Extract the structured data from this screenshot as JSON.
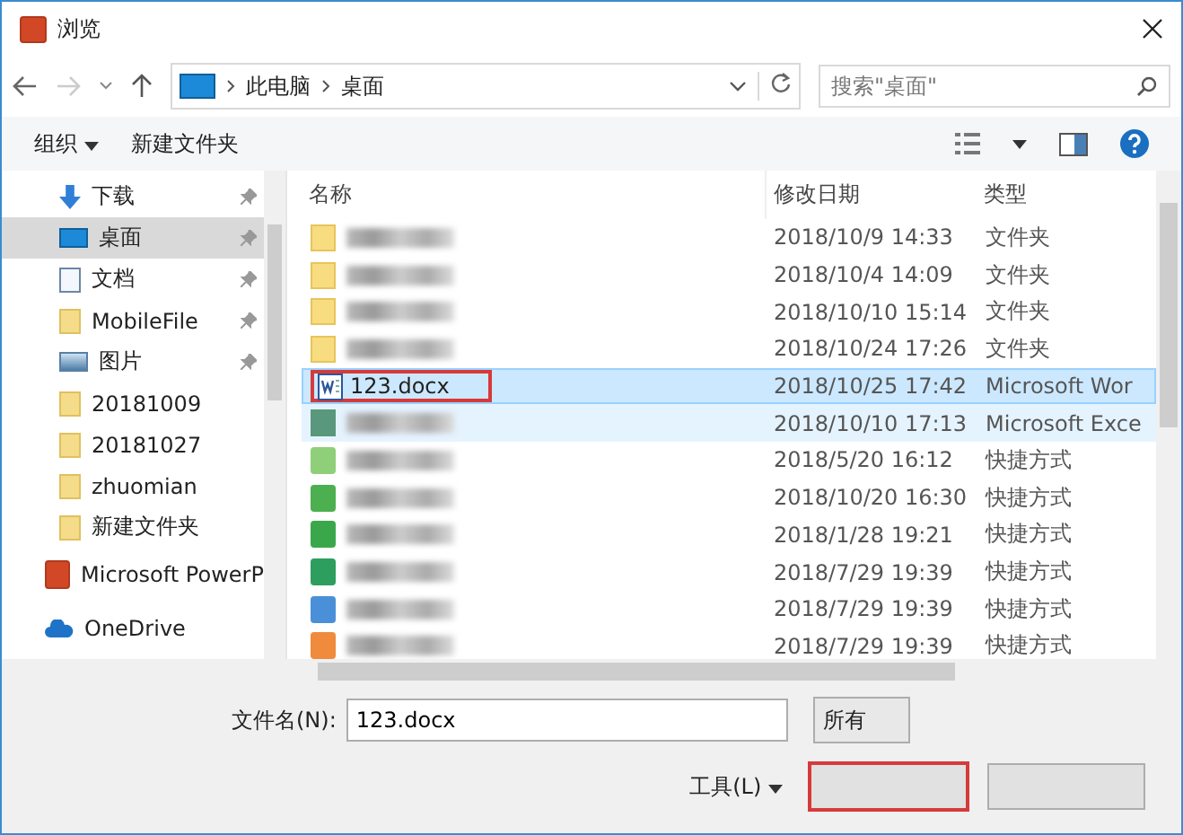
{
  "window": {
    "title": "浏览"
  },
  "address": {
    "path": [
      "此电脑",
      "桌面"
    ],
    "search_placeholder": "搜索\"桌面\""
  },
  "toolbar": {
    "organize": "组织",
    "new_folder": "新建文件夹"
  },
  "sidebar": {
    "items": [
      {
        "kind": "download",
        "label": "下载",
        "pinned": true,
        "selected": false
      },
      {
        "kind": "desktop",
        "label": "桌面",
        "pinned": true,
        "selected": true
      },
      {
        "kind": "document",
        "label": "文档",
        "pinned": true,
        "selected": false
      },
      {
        "kind": "folder",
        "label": "MobileFile",
        "pinned": true,
        "selected": false
      },
      {
        "kind": "pictures",
        "label": "图片",
        "pinned": true,
        "selected": false
      },
      {
        "kind": "folder",
        "label": "20181009",
        "pinned": false,
        "selected": false
      },
      {
        "kind": "folder",
        "label": "20181027",
        "pinned": false,
        "selected": false
      },
      {
        "kind": "folder",
        "label": "zhuomian",
        "pinned": false,
        "selected": false
      },
      {
        "kind": "folder",
        "label": "新建文件夹",
        "pinned": false,
        "selected": false
      }
    ],
    "groups": [
      {
        "kind": "app",
        "label": "Microsoft PowerP"
      },
      {
        "kind": "cloud",
        "label": "OneDrive"
      }
    ]
  },
  "table": {
    "columns": [
      "名称",
      "修改日期",
      "类型"
    ],
    "rows": [
      {
        "kind": "folder",
        "date": "2018/10/9 14:33",
        "type": "文件夹",
        "selected": false,
        "hover": false
      },
      {
        "kind": "folder",
        "date": "2018/10/4 14:09",
        "type": "文件夹",
        "selected": false,
        "hover": false
      },
      {
        "kind": "folder",
        "date": "2018/10/10 15:14",
        "type": "文件夹",
        "selected": false,
        "hover": false
      },
      {
        "kind": "folder",
        "date": "2018/10/24 17:26",
        "type": "文件夹",
        "selected": false,
        "hover": false
      },
      {
        "kind": "word",
        "name": "123.docx",
        "date": "2018/10/25 17:42",
        "type": "Microsoft Wor",
        "selected": true,
        "hover": false
      },
      {
        "kind": "excel",
        "date": "2018/10/10 17:13",
        "type": "Microsoft Exce",
        "selected": false,
        "hover": true
      },
      {
        "kind": "shortcut",
        "color": "#8fcf7a",
        "date": "2018/5/20 16:12",
        "type": "快捷方式",
        "selected": false,
        "hover": false
      },
      {
        "kind": "shortcut",
        "color": "#4caf50",
        "date": "2018/10/20 16:30",
        "type": "快捷方式",
        "selected": false,
        "hover": false
      },
      {
        "kind": "shortcut",
        "color": "#3aa84a",
        "date": "2018/1/28 19:21",
        "type": "快捷方式",
        "selected": false,
        "hover": false
      },
      {
        "kind": "shortcut",
        "color": "#2e9e5e",
        "date": "2018/7/29 19:39",
        "type": "快捷方式",
        "selected": false,
        "hover": false
      },
      {
        "kind": "shortcut",
        "color": "#4a90d9",
        "date": "2018/7/29 19:39",
        "type": "快捷方式",
        "selected": false,
        "hover": false
      },
      {
        "kind": "shortcut",
        "color": "#f08a3c",
        "date": "2018/7/29 19:39",
        "type": "快捷方式",
        "selected": false,
        "hover": false
      }
    ]
  },
  "footer": {
    "filename_label": "文件名(N):",
    "filename": "123.docx",
    "filetype": "所有",
    "tools": "工具(L)"
  }
}
